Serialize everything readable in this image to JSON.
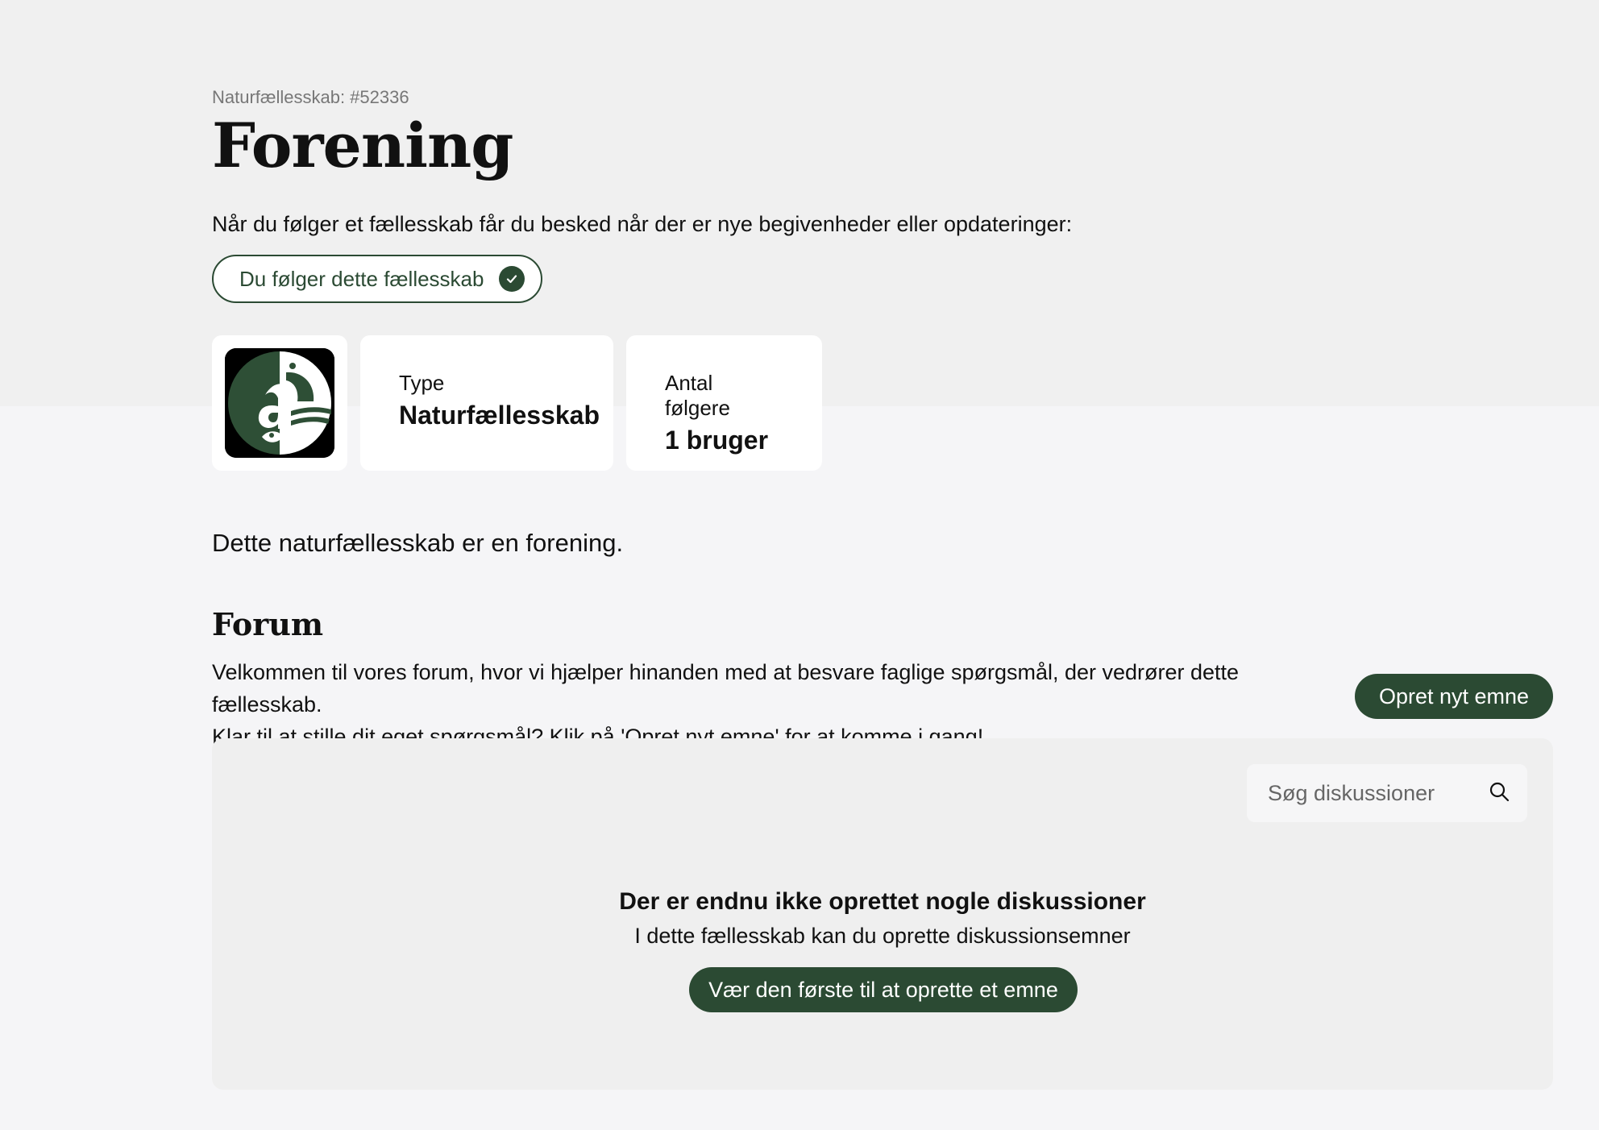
{
  "header": {
    "breadcrumb": "Naturfællesskab: #52336",
    "title": "Forening",
    "follow_text": "Når du følger et fællesskab får du besked når der er nye begivenheder eller opdateringer:",
    "follow_button_label": "Du følger dette fællesskab",
    "follow_icon": "check-icon"
  },
  "cards": {
    "logo_icon": "community-logo",
    "type_label": "Type",
    "type_value": "Naturfællesskab",
    "followers_label": "Antal følgere",
    "followers_value": "1 bruger"
  },
  "description": "Dette naturfællesskab er en forening.",
  "forum": {
    "title": "Forum",
    "intro_line1": "Velkommen til vores forum, hvor vi hjælper hinanden med at besvare faglige spørgsmål, der vedrører dette fællesskab.",
    "intro_line2": "Klar til at stille dit eget spørgsmål? Klik på 'Opret nyt emne' for at komme i gang!",
    "new_topic_label": "Opret nyt emne",
    "search_placeholder": "Søg diskussioner",
    "search_icon": "search-icon",
    "empty_title": "Der er endnu ikke oprettet nogle diskussioner",
    "empty_subtitle": "I dette fællesskab kan du oprette diskussionsemner",
    "first_topic_label": "Vær den første til at oprette et emne"
  },
  "colors": {
    "accent": "#2b4a33",
    "hero_bg": "#f0f0f0",
    "page_bg": "#f5f5f7"
  }
}
